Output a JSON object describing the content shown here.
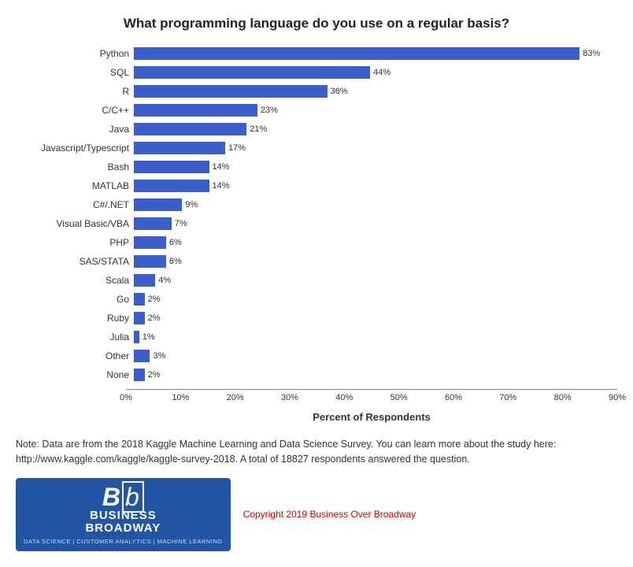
{
  "title": "What programming language do you use on a regular basis?",
  "bars": [
    {
      "label": "Python",
      "value": 83,
      "display": "83%"
    },
    {
      "label": "SQL",
      "value": 44,
      "display": "44%"
    },
    {
      "label": "R",
      "value": 36,
      "display": "36%"
    },
    {
      "label": "C/C++",
      "value": 23,
      "display": "23%"
    },
    {
      "label": "Java",
      "value": 21,
      "display": "21%"
    },
    {
      "label": "Javascript/Typescript",
      "value": 17,
      "display": "17%"
    },
    {
      "label": "Bash",
      "value": 14,
      "display": "14%"
    },
    {
      "label": "MATLAB",
      "value": 14,
      "display": "14%"
    },
    {
      "label": "C#/.NET",
      "value": 9,
      "display": "9%"
    },
    {
      "label": "Visual Basic/VBA",
      "value": 7,
      "display": "7%"
    },
    {
      "label": "PHP",
      "value": 6,
      "display": "6%"
    },
    {
      "label": "SAS/STATA",
      "value": 6,
      "display": "6%"
    },
    {
      "label": "Scala",
      "value": 4,
      "display": "4%"
    },
    {
      "label": "Go",
      "value": 2,
      "display": "2%"
    },
    {
      "label": "Ruby",
      "value": 2,
      "display": "2%"
    },
    {
      "label": "Julia",
      "value": 1,
      "display": "1%"
    },
    {
      "label": "Other",
      "value": 3,
      "display": "3%"
    },
    {
      "label": "None",
      "value": 2,
      "display": "2%"
    }
  ],
  "xAxis": {
    "ticks": [
      "0%",
      "10%",
      "20%",
      "30%",
      "40%",
      "50%",
      "60%",
      "70%",
      "80%",
      "90%"
    ],
    "max": 90,
    "label": "Percent of Respondents"
  },
  "note": "Note: Data are from the 2018 Kaggle Machine Learning and Data Science Survey. You can learn more about the study here: http://www.kaggle.com/kaggle/kaggle-survey-2018.  A total of 18827 respondents answered the question.",
  "logo": {
    "initials": "Bb",
    "line1": "BUSINESS",
    "line2": "BROADWAY",
    "tagline": "DATA SCIENCE  |  CUSTOMER ANALYTICS  |  MACHINE LEARNING"
  },
  "copyright": "Copyright 2019 Business Over Broadway"
}
